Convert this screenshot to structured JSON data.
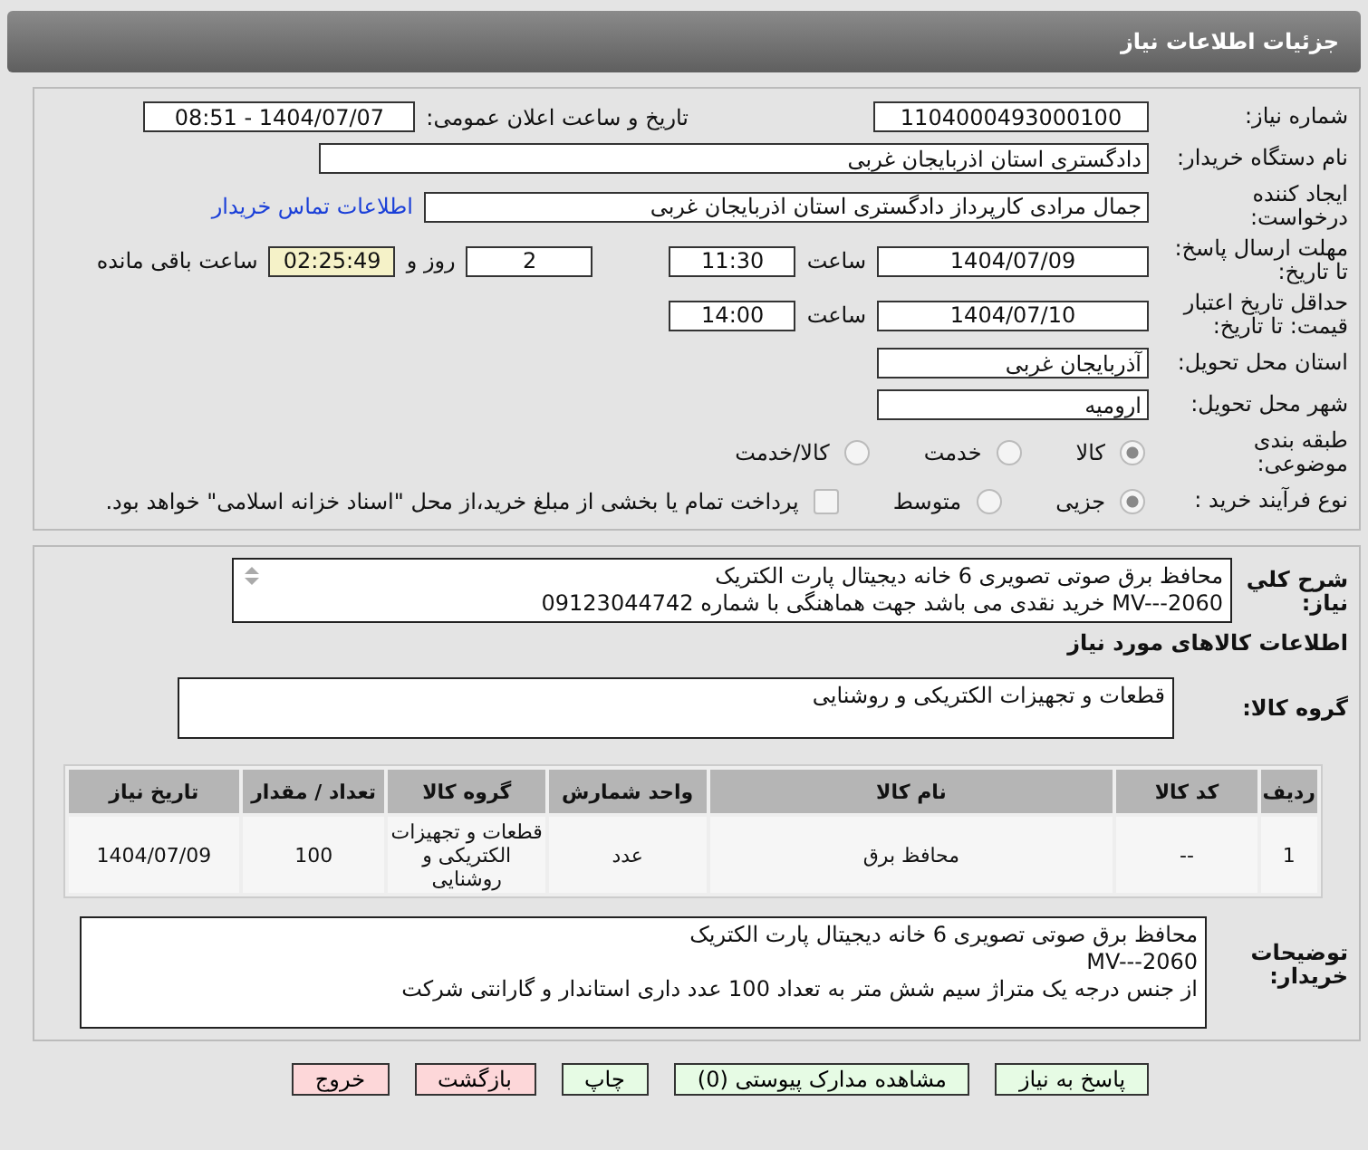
{
  "header": {
    "title": "جزئیات اطلاعات نیاز"
  },
  "need_number": {
    "label": "شماره نیاز:",
    "value": "1104000493000100"
  },
  "announce": {
    "label": "تاریخ و ساعت اعلان عمومی:",
    "value": "1404/07/07 - 08:51"
  },
  "buyer_org": {
    "label": "نام دستگاه خریدار:",
    "value": "دادگستری استان اذربایجان غربی"
  },
  "creator": {
    "label": "ایجاد کننده درخواست:",
    "value": "جمال مرادی کارپرداز دادگستری استان اذربایجان غربی",
    "link": "اطلاعات تماس خریدار"
  },
  "deadline": {
    "label": "مهلت ارسال پاسخ: تا تاریخ:",
    "date": "1404/07/09",
    "time_label": "ساعت",
    "time": "11:30",
    "days": "2",
    "days_label": "روز و",
    "remaining": "02:25:49",
    "remaining_label": "ساعت باقی مانده"
  },
  "validity": {
    "label": "حداقل تاریخ اعتبار قیمت: تا تاریخ:",
    "date": "1404/07/10",
    "time_label": "ساعت",
    "time": "14:00"
  },
  "province": {
    "label": "استان محل تحویل:",
    "value": "آذربایجان غربی"
  },
  "city": {
    "label": "شهر محل تحویل:",
    "value": "ارومیه"
  },
  "category": {
    "label": "طبقه بندی موضوعی:",
    "options": [
      {
        "label": "کالا",
        "selected": true
      },
      {
        "label": "خدمت",
        "selected": false
      },
      {
        "label": "کالا/خدمت",
        "selected": false
      }
    ]
  },
  "process": {
    "label": "نوع فرآیند خرید :",
    "options": [
      {
        "label": "جزیی",
        "selected": true
      },
      {
        "label": "متوسط",
        "selected": false
      }
    ],
    "payment": {
      "checked": false,
      "label": "پرداخت تمام یا بخشی از مبلغ خرید،از محل \"اسناد خزانه اسلامی\" خواهد بود."
    }
  },
  "summary": {
    "label": "شرح کلي نياز:",
    "lines": [
      "محافظ برق صوتی تصویری 6 خانه دیجیتال پارت الکتریک",
      "MV---2060   خرید نقدی می باشد جهت هماهنگی با شماره 09123044742"
    ]
  },
  "goods_title": "اطلاعات کالاهای مورد نیاز",
  "goods_group": {
    "label": "گروه کالا:",
    "value": "قطعات و تجهیزات الکتریکی و روشنایی"
  },
  "table": {
    "columns": [
      "ردیف",
      "کد کالا",
      "نام کالا",
      "واحد شمارش",
      "گروه کالا",
      "تعداد / مقدار",
      "تاریخ نیاز"
    ],
    "rows": [
      [
        "1",
        "--",
        "محافظ برق",
        "عدد",
        "قطعات و تجهیزات الکتریکی و روشنایی",
        "100",
        "1404/07/09"
      ]
    ]
  },
  "notes": {
    "label": "توضیحات خریدار:",
    "lines": [
      "محافظ برق صوتی تصویری 6 خانه دیجیتال پارت الکتریک",
      "MV---2060",
      "از جنس درجه یک متراژ سیم شش متر به تعداد 100 عدد داری استاندار  و گارانتی شرکت"
    ]
  },
  "buttons": [
    {
      "label": "پاسخ به نیاز",
      "kind": "action"
    },
    {
      "label": "مشاهده مدارک پیوستی (0)",
      "kind": "action"
    },
    {
      "label": "چاپ",
      "kind": "action"
    },
    {
      "label": "بازگشت",
      "kind": "exit"
    },
    {
      "label": "خروج",
      "kind": "exit"
    }
  ]
}
